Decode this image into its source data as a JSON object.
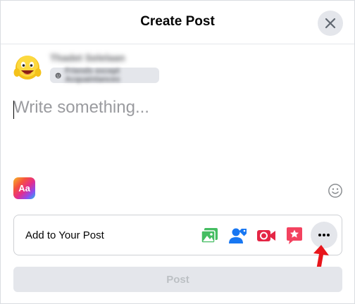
{
  "dialog": {
    "title": "Create Post",
    "close_icon": "close-icon"
  },
  "user": {
    "name": "Thadet Selelaan",
    "audience": "Friends except Acquaintances",
    "audience_icon": "globe-icon"
  },
  "composer": {
    "placeholder": "Write something...",
    "text_format_label": "Aa",
    "emoji_icon": "smiley-icon"
  },
  "add_to_post": {
    "label": "Add to Your Post",
    "tools": [
      {
        "name": "photo-video-icon",
        "color": "#45bd62"
      },
      {
        "name": "tag-people-icon",
        "color": "#1877f2"
      },
      {
        "name": "live-video-icon",
        "color": "#e42645"
      },
      {
        "name": "feeling-activity-icon",
        "color": "#f3425f"
      },
      {
        "name": "more-options-icon",
        "color": "#050505"
      }
    ]
  },
  "annotation": {
    "arrow_color": "#e8151b"
  },
  "post_button": {
    "label": "Post"
  },
  "colors": {
    "accent": "#1877f2",
    "disabled_bg": "#e4e6eb",
    "disabled_text": "#bcc0c4"
  }
}
